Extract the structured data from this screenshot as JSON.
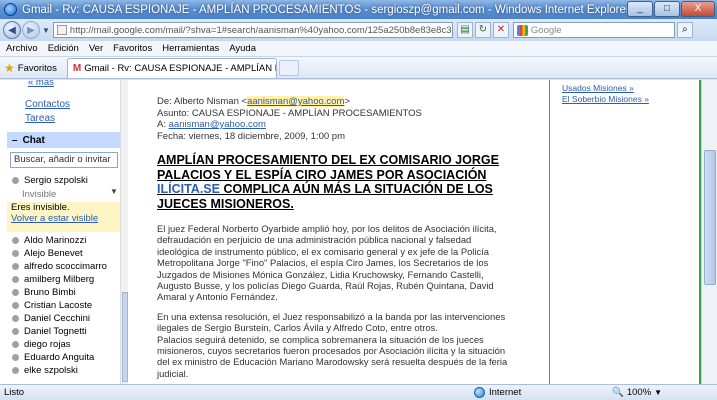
{
  "window": {
    "title": "Gmail - Rv: CAUSA ESPIONAJE - AMPLÍAN PROCESAMIENTOS - sergioszp@gmail.com - Windows Internet Explorer",
    "minimize": "_",
    "maximize": "□",
    "close": "X"
  },
  "browser": {
    "address": "http://mail.google.com/mail/?shva=1#search/aanisman%40yahoo.com/125a250b8e83e8c3",
    "search_placeholder": "Google",
    "menu": [
      "Archivo",
      "Edición",
      "Ver",
      "Favoritos",
      "Herramientas",
      "Ayuda"
    ],
    "favorites_label": "Favoritos",
    "tab_title": "Gmail - Rv: CAUSA ESPIONAJE - AMPLÍAN PROCESAM..."
  },
  "sidebar": {
    "more": "« más",
    "contacts": "Contactos",
    "tasks": "Tareas",
    "chat_title": "Chat",
    "chat_search": "Buscar, añadir o invitar",
    "me_name": "Sergio szpolski",
    "me_status": "Invisible",
    "invisible_msg": "Eres invisible.",
    "visible_link": "Volver a estar visible",
    "contacts_list": [
      "Aldo Marinozzi",
      "Alejo Benevet",
      "alfredo scoccimarro",
      "amilberg Milberg",
      "Bruno Bimbi",
      "Cristian Lacoste",
      "Daniel Cecchini",
      "Daniel Tognetti",
      "diego rojas",
      "Eduardo Anguita",
      "elke szpolski"
    ]
  },
  "mail": {
    "from_label": "De:",
    "from_name": "Alberto Nisman",
    "from_email": "aanisman@yahoo.com",
    "subject_label": "Asunto:",
    "subject": "CAUSA ESPIONAJE - AMPLÍAN PROCESAMIENTOS",
    "to_label": "A:",
    "to_email": "aanisman@yahoo.com",
    "date_label": "Fecha:",
    "date": "viernes, 18 diciembre, 2009, 1:00 pm",
    "headline_a": "AMPLÍAN PROCESAMIENTO DEL EX COMISARIO JORGE PALACIOS Y EL ESPÍA CIRO JAMES POR ASOCIACIÓN ",
    "headline_link": "ILÍCITA.SE",
    "headline_b": " COMPLICA AÚN MÁS LA SITUACIÓN DE LOS JUECES MISIONEROS.",
    "para1": "El juez Federal Norberto Oyarbide amplió hoy, por los delitos de Asociación ilícita, defraudación en perjuicio de una administración pública nacional y falsedad ideológica de instrumento público, el ex comisario general y ex jefe de la Policía Metropolitana Jorge \"Fino\" Palacios, el espía Ciro James, los Secretarios de los Juzgados de Misiones Mónica González, Lidia Kruchowsky, Fernando Castelli, Augusto Busse, y los policías Diego Guarda, Raúl Rojas, Rubén Quintana, David Amaral y Antonio Fernández.",
    "para2": "En una extensa resolución, el Juez responsabilizó a la banda por las intervenciones ilegales de Sergio Burstein, Carlos Ávila y Alfredo Coto, entre otros.",
    "para3": "Palacios seguirá detenido, se complica sobremanera la situación de los jueces misioneros, cuyos secretarios fueron procesados por Asociación ilícita y la situación del ex ministro de Educación Mariano Marodowsky será resuelta después de la feria judicial."
  },
  "right": {
    "links": [
      "Usados Misiones »",
      "El Soberbio Misiones »"
    ]
  },
  "status": {
    "ready": "Listo",
    "zone": "Internet",
    "zoom": "100%"
  }
}
